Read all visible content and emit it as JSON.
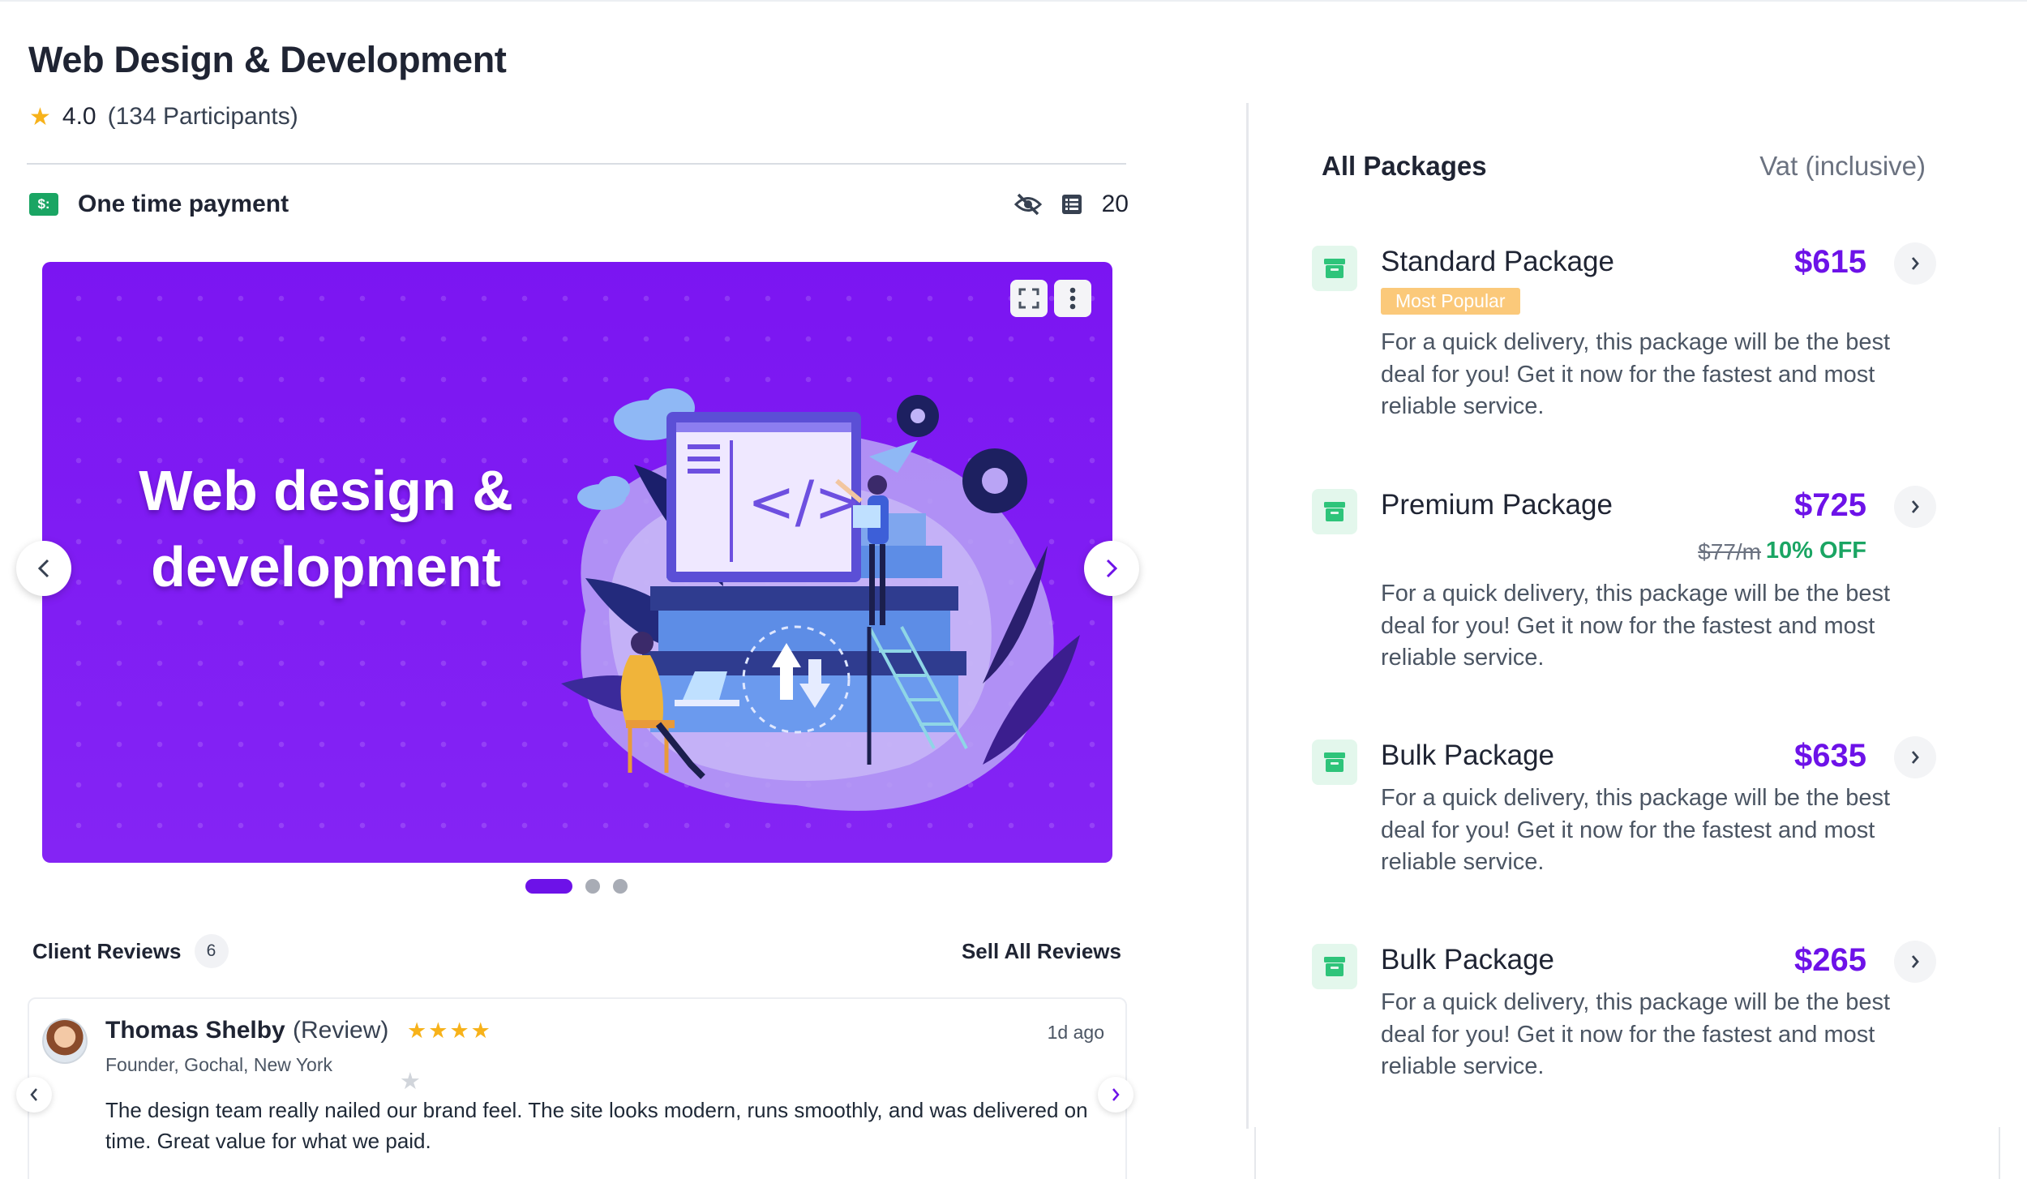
{
  "product": {
    "title": "Web Design & Development",
    "rating": "4.0",
    "participants": "(134 Participants)"
  },
  "payment": {
    "label": "One time payment",
    "icon": "money-icon",
    "count": "20"
  },
  "banner": {
    "headline_line1": "Web design &",
    "headline_line2": "development",
    "slides_total": 3,
    "active_slide": 1
  },
  "reviews": {
    "title": "Client Reviews",
    "count": "6",
    "see_all": "Sell All Reviews",
    "item": {
      "name": "Thomas Shelby",
      "tag": "(Review)",
      "stars": 4,
      "stars_max": 5,
      "time": "1d ago",
      "role": "Founder, Gochal, New York",
      "text": "The design team really nailed our brand feel. The site looks modern, runs smoothly, and was delivered on time. Great value for what we paid."
    }
  },
  "packages": {
    "heading": "All Packages",
    "vat": "Vat (inclusive)",
    "items": [
      {
        "name": "Standard Package",
        "price": "$615",
        "badge": "Most Popular",
        "description": "For a quick delivery, this package will be the best deal for you! Get it now for the fastest and most reliable service."
      },
      {
        "name": "Premium Package",
        "price": "$725",
        "old_price": "$77/m",
        "discount": "10% OFF",
        "description": "For a quick delivery, this package will be the best deal for you! Get it now for the fastest and most reliable service."
      },
      {
        "name": "Bulk Package",
        "price": "$635",
        "description": "For a quick delivery, this package will be the best deal for you! Get it now for the fastest and most reliable service."
      },
      {
        "name": "Bulk Package",
        "price": "$265",
        "description": "For a quick delivery, this package will be the best deal for you! Get it now for the fastest and most reliable service."
      }
    ]
  },
  "colors": {
    "accent": "#6d12e8",
    "success": "#1aa563",
    "star": "#f7b21a",
    "badge": "#fbc97a"
  }
}
